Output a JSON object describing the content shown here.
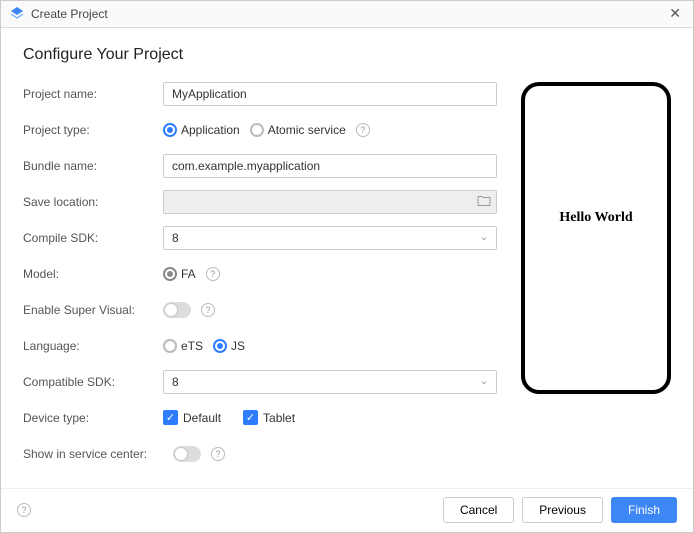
{
  "window": {
    "title": "Create Project"
  },
  "heading": "Configure Your Project",
  "labels": {
    "project_name": "Project name:",
    "project_type": "Project type:",
    "bundle_name": "Bundle name:",
    "save_location": "Save location:",
    "compile_sdk": "Compile SDK:",
    "model": "Model:",
    "enable_super_visual": "Enable Super Visual:",
    "language": "Language:",
    "compatible_sdk": "Compatible SDK:",
    "device_type": "Device type:",
    "show_in_service_center": "Show in service center:"
  },
  "values": {
    "project_name": "MyApplication",
    "bundle_name": "com.example.myapplication",
    "save_location": "",
    "compile_sdk": "8",
    "compatible_sdk": "8"
  },
  "project_type": {
    "options": {
      "application": "Application",
      "atomic_service": "Atomic service"
    },
    "selected": "application"
  },
  "model": {
    "options": {
      "fa": "FA"
    },
    "selected": "fa"
  },
  "super_visual": {
    "enabled": false
  },
  "language": {
    "options": {
      "ets": "eTS",
      "js": "JS"
    },
    "selected": "js"
  },
  "device_type": {
    "default": {
      "label": "Default",
      "checked": true
    },
    "tablet": {
      "label": "Tablet",
      "checked": true
    }
  },
  "show_in_service_center": {
    "enabled": false
  },
  "preview": {
    "text": "Hello World"
  },
  "buttons": {
    "cancel": "Cancel",
    "previous": "Previous",
    "finish": "Finish"
  }
}
